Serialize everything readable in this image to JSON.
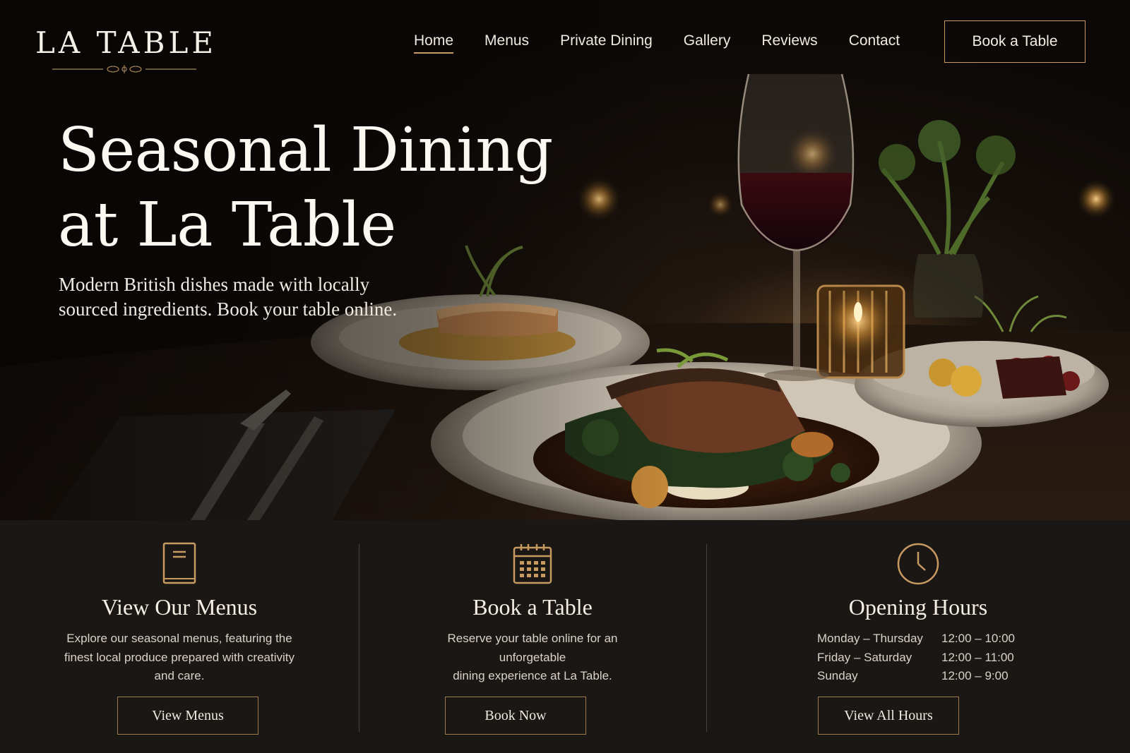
{
  "brand": {
    "name": "LA TABLE"
  },
  "nav": {
    "items": [
      {
        "label": "Home",
        "active": true
      },
      {
        "label": "Menus",
        "active": false
      },
      {
        "label": "Private Dining",
        "active": false
      },
      {
        "label": "Gallery",
        "active": false
      },
      {
        "label": "Reviews",
        "active": false
      },
      {
        "label": "Contact",
        "active": false
      }
    ],
    "cta_label": "Book a Table"
  },
  "hero": {
    "title_line1": "Seasonal Dining",
    "title_line2": "at La Table",
    "subtitle_line1": "Modern British dishes made with locally",
    "subtitle_line2": "sourced ingredients. Book your table online."
  },
  "features": {
    "menus": {
      "icon": "menu-book-icon",
      "title": "View Our Menus",
      "desc_line1": "Explore our seasonal menus, featuring the",
      "desc_line2": "finest local produce prepared with creativity",
      "desc_line3": "and care.",
      "button": "View Menus"
    },
    "booking": {
      "icon": "calendar-icon",
      "title": "Book a Table",
      "desc_line1": "Reserve your table online for an unforgetable",
      "desc_line2": "dining experience at La Table.",
      "button": "Book Now"
    },
    "hours": {
      "icon": "clock-icon",
      "title": "Opening Hours",
      "rows": [
        {
          "days": "Monday – Thursday",
          "time": "12:00 – 10:00"
        },
        {
          "days": "Friday – Saturday",
          "time": "12:00 – 11:00"
        },
        {
          "days": "Sunday",
          "time": "12:00 – 9:00"
        }
      ],
      "button": "View All Hours"
    }
  },
  "colors": {
    "accent_gold": "#c79a62",
    "background_dark": "#1b1714",
    "text_light": "#f3ede4"
  }
}
